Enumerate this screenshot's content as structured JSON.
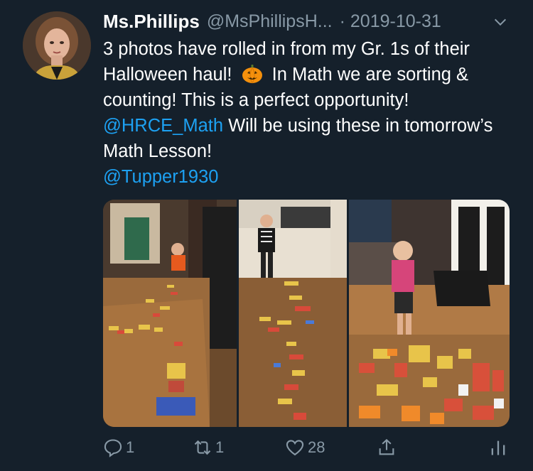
{
  "tweet": {
    "author_name": "Ms.Phillips",
    "author_handle": "@MsPhillipsH...",
    "date": "· 2019-10-31",
    "text_1": "3 photos have rolled in from my Gr. 1s of their Halloween haul!",
    "emoji": "pumpkin-emoji",
    "text_2": "In Math we are sorting & counting! This is a perfect opportunity!",
    "mention_1": "@HRCE_Math",
    "text_3": "Will be using these in tomorrow’s Math Lesson!",
    "mention_2": "@Tupper1930"
  },
  "actions": {
    "reply_count": "1",
    "retweet_count": "1",
    "like_count": "28"
  },
  "colors": {
    "background": "#15202b",
    "mention": "#1da1f2",
    "muted": "#8899a6"
  }
}
